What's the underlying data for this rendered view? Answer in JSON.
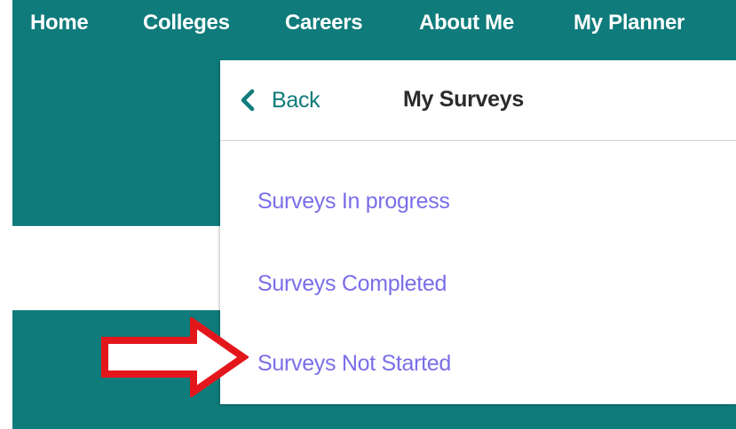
{
  "nav": {
    "items": [
      {
        "label": "Home"
      },
      {
        "label": "Colleges"
      },
      {
        "label": "Careers"
      },
      {
        "label": "About Me"
      },
      {
        "label": "My Planner"
      }
    ]
  },
  "panel": {
    "back_label": "Back",
    "title": "My Surveys",
    "links": [
      {
        "label": "Surveys In progress"
      },
      {
        "label": "Surveys Completed"
      },
      {
        "label": "Surveys Not Started"
      }
    ]
  },
  "colors": {
    "brand_teal": "#0f7b7b",
    "link_purple": "#7a6ee8",
    "annotation_arrow": "#e3161b"
  },
  "icons": {
    "back": "chevron-left-icon",
    "annotation": "arrow-right-icon"
  }
}
